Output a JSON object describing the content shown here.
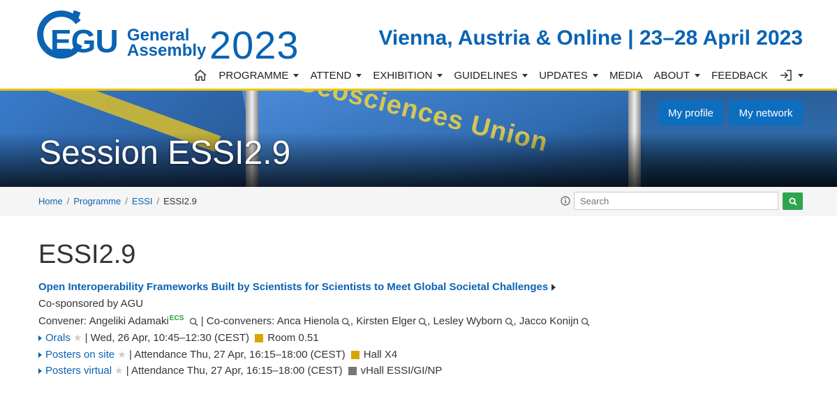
{
  "logo": {
    "egu": "EGU",
    "general": "General",
    "assembly": "Assembly",
    "year": "2023"
  },
  "tagline": "Vienna, Austria & Online | 23–28 April 2023",
  "nav": [
    "PROGRAMME",
    "ATTEND",
    "EXHIBITION",
    "GUIDELINES",
    "UPDATES",
    "MEDIA",
    "ABOUT",
    "FEEDBACK"
  ],
  "banner": {
    "title": "Session ESSI2.9",
    "flag_text": "Geosciences Union",
    "my_profile": "My profile",
    "my_network": "My network"
  },
  "breadcrumb": [
    "Home",
    "Programme",
    "ESSI",
    "ESSI2.9"
  ],
  "search": {
    "placeholder": "Search"
  },
  "session": {
    "id": "ESSI2.9",
    "title": "Open Interoperability Frameworks Built by Scientists for Scientists to Meet Global Societal Challenges",
    "cosponsor": "Co-sponsored by AGU",
    "convener_label": "Convener:",
    "convener": "Angeliki Adamaki",
    "ecs": "ECS",
    "coconveners_label": "| Co-conveners:",
    "coconveners": [
      "Anca Hienola",
      "Kirsten Elger",
      "Lesley Wyborn",
      "Jacco Konijn"
    ],
    "orals": {
      "label": "Orals",
      "time": "| Wed, 26 Apr, 10:45–12:30 (CEST)",
      "room": "Room 0.51"
    },
    "posters_site": {
      "label": "Posters on site",
      "time": "| Attendance Thu, 27 Apr, 16:15–18:00 (CEST)",
      "room": "Hall X4"
    },
    "posters_virtual": {
      "label": "Posters virtual",
      "time": "| Attendance Thu, 27 Apr, 16:15–18:00 (CEST)",
      "room": "vHall ESSI/GI/NP"
    }
  },
  "colors": {
    "brand_blue": "#0a63b3",
    "accent_yellow": "#f0c400",
    "room_yellow": "#d9a400",
    "vhall_gray": "#777777",
    "search_green": "#2ea44f"
  }
}
